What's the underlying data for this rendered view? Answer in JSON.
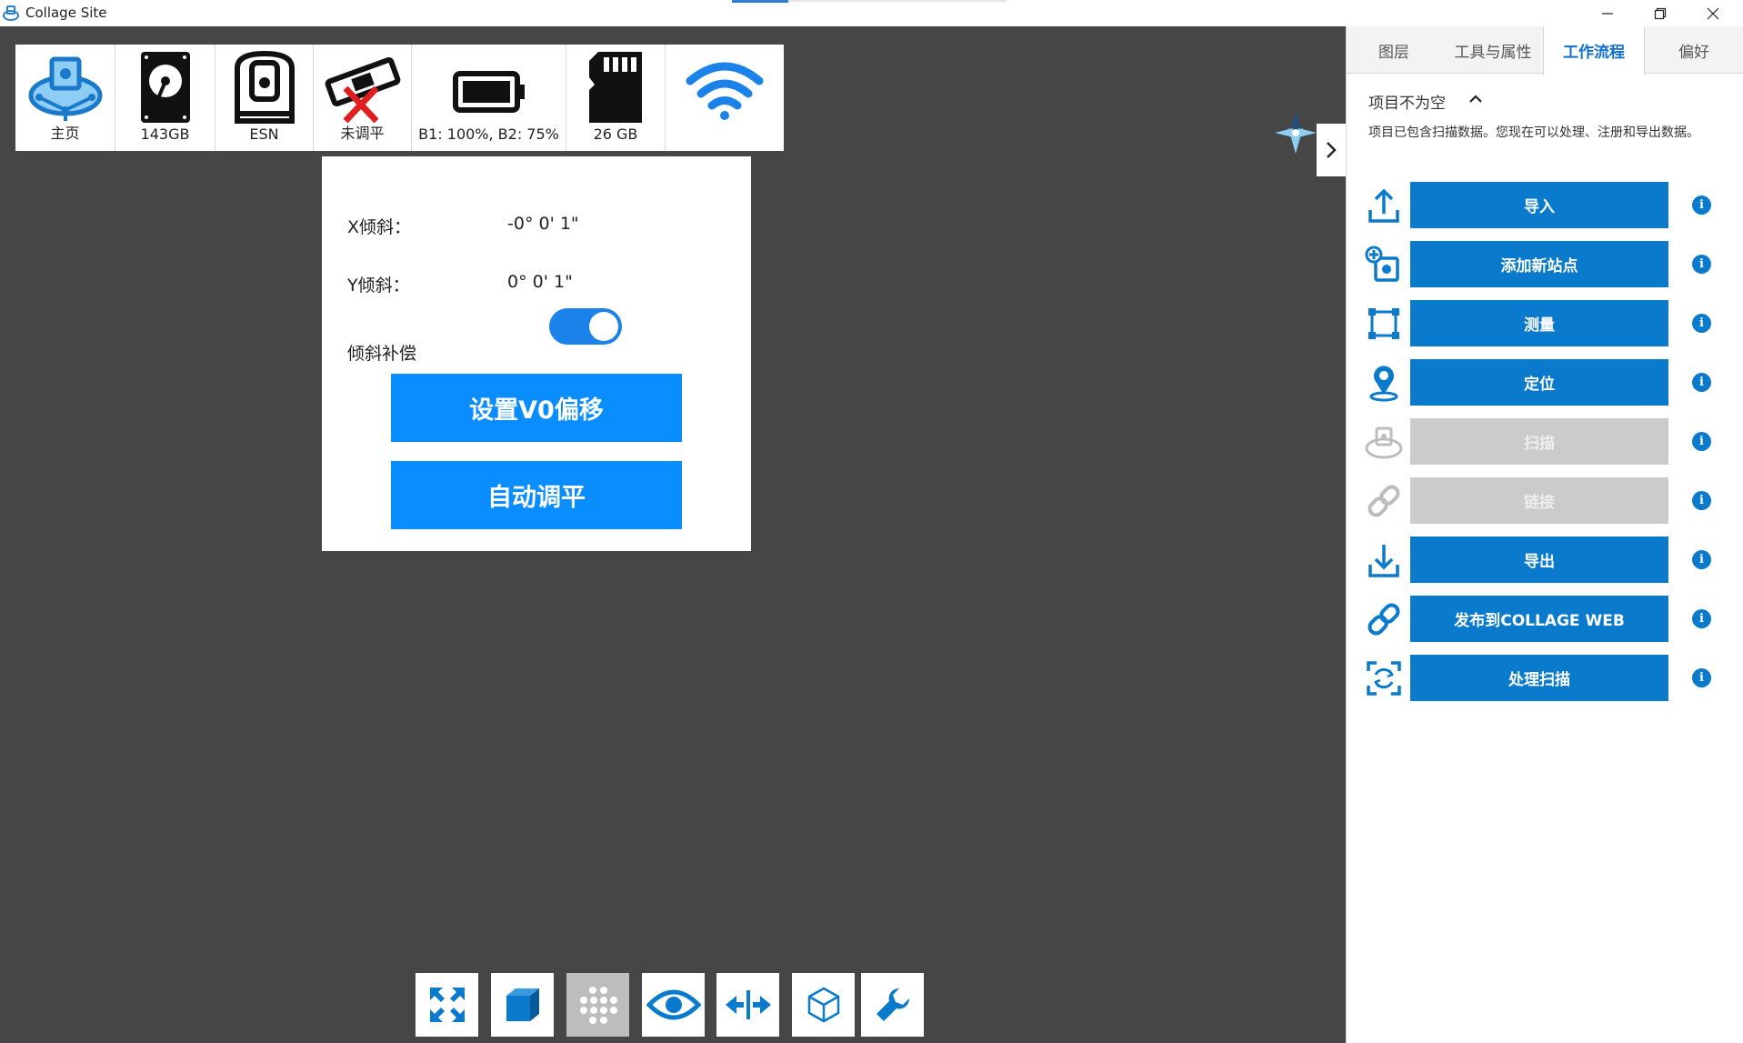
{
  "window": {
    "title": "Collage Site"
  },
  "status_bar": {
    "items": [
      {
        "icon": "home-scanner-icon",
        "label": "主页"
      },
      {
        "icon": "hard-drive-icon",
        "label": "143GB"
      },
      {
        "icon": "esn-scanner-icon",
        "label": "ESN"
      },
      {
        "icon": "level-not-leveled-icon",
        "label": "未调平"
      },
      {
        "icon": "battery-icon",
        "label": "B1: 100%, B2: 75%"
      },
      {
        "icon": "sd-card-icon",
        "label": "26 GB"
      },
      {
        "icon": "wifi-icon",
        "label": ""
      }
    ]
  },
  "level_panel": {
    "x_tilt_label": "X倾斜：",
    "x_tilt_value": "-0° 0' 1\"",
    "y_tilt_label": "Y倾斜：",
    "y_tilt_value": "0° 0' 1\"",
    "compensation_label": "倾斜补偿",
    "compensation_on": true,
    "set_v0_button": "设置V0偏移",
    "auto_level_button": "自动调平"
  },
  "right_panel": {
    "tabs": [
      {
        "label": "图层",
        "active": false
      },
      {
        "label": "工具与属性",
        "active": false
      },
      {
        "label": "工作流程",
        "active": true
      },
      {
        "label": "偏好",
        "active": false
      }
    ],
    "section_title": "项目不为空",
    "section_desc": "项目已包含扫描数据。您现在可以处理、注册和导出数据。",
    "workflow": [
      {
        "label": "导入",
        "icon": "upload-icon",
        "enabled": true
      },
      {
        "label": "添加新站点",
        "icon": "add-station-icon",
        "enabled": true
      },
      {
        "label": "测量",
        "icon": "measure-icon",
        "enabled": true
      },
      {
        "label": "定位",
        "icon": "location-pin-icon",
        "enabled": true
      },
      {
        "label": "扫描",
        "icon": "scanner-icon",
        "enabled": false
      },
      {
        "label": "链接",
        "icon": "link-icon",
        "enabled": false
      },
      {
        "label": "导出",
        "icon": "download-icon",
        "enabled": true
      },
      {
        "label": "发布到COLLAGE WEB",
        "icon": "publish-link-icon",
        "enabled": true
      },
      {
        "label": "处理扫描",
        "icon": "process-scan-icon",
        "enabled": true
      }
    ],
    "info_glyph": "i"
  },
  "toolbar": {
    "tools": [
      {
        "icon": "fit-view-icon",
        "active": false
      },
      {
        "icon": "solid-cube-icon",
        "active": false
      },
      {
        "icon": "dot-grid-icon",
        "active": true
      },
      {
        "icon": "eye-icon",
        "active": false
      },
      {
        "icon": "split-view-icon",
        "active": false
      },
      {
        "icon": "wire-cube-icon",
        "active": false
      },
      {
        "icon": "wrench-icon",
        "active": false
      }
    ]
  },
  "colors": {
    "viewport_bg": "#464646",
    "primary_blue": "#0a7acc",
    "bright_blue": "#0a8eff",
    "disabled_gray": "#cbcbcb"
  }
}
